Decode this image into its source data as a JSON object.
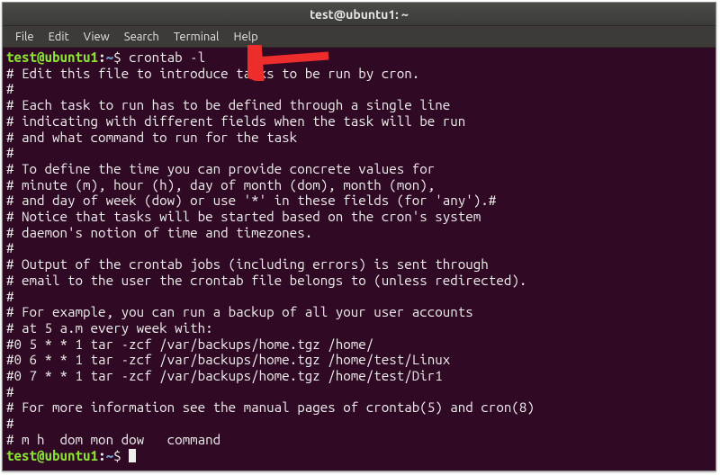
{
  "window": {
    "title": "test@ubuntu1: ~"
  },
  "menu": {
    "file": "File",
    "edit": "Edit",
    "view": "View",
    "search": "Search",
    "terminal": "Terminal",
    "help": "Help"
  },
  "prompt": {
    "userhost": "test@ubuntu1",
    "colon": ":",
    "path": "~",
    "dollar": "$ "
  },
  "command": "crontab -l",
  "output": [
    "# Edit this file to introduce tasks to be run by cron.",
    "# ",
    "# Each task to run has to be defined through a single line",
    "# indicating with different fields when the task will be run",
    "# and what command to run for the task",
    "# ",
    "# To define the time you can provide concrete values for",
    "# minute (m), hour (h), day of month (dom), month (mon),",
    "# and day of week (dow) or use '*' in these fields (for 'any').#",
    "# Notice that tasks will be started based on the cron's system",
    "# daemon's notion of time and timezones.",
    "# ",
    "# Output of the crontab jobs (including errors) is sent through",
    "# email to the user the crontab file belongs to (unless redirected).",
    "# ",
    "# For example, you can run a backup of all your user accounts",
    "# at 5 a.m every week with:",
    "#0 5 * * 1 tar -zcf /var/backups/home.tgz /home/",
    "#0 6 * * 1 tar -zcf /var/backups/home.tgz /home/test/Linux",
    "#0 7 * * 1 tar -zcf /var/backups/home.tgz /home/test/Dir1",
    "# ",
    "# For more information see the manual pages of crontab(5) and cron(8)",
    "# ",
    "# m h  dom mon dow   command"
  ]
}
